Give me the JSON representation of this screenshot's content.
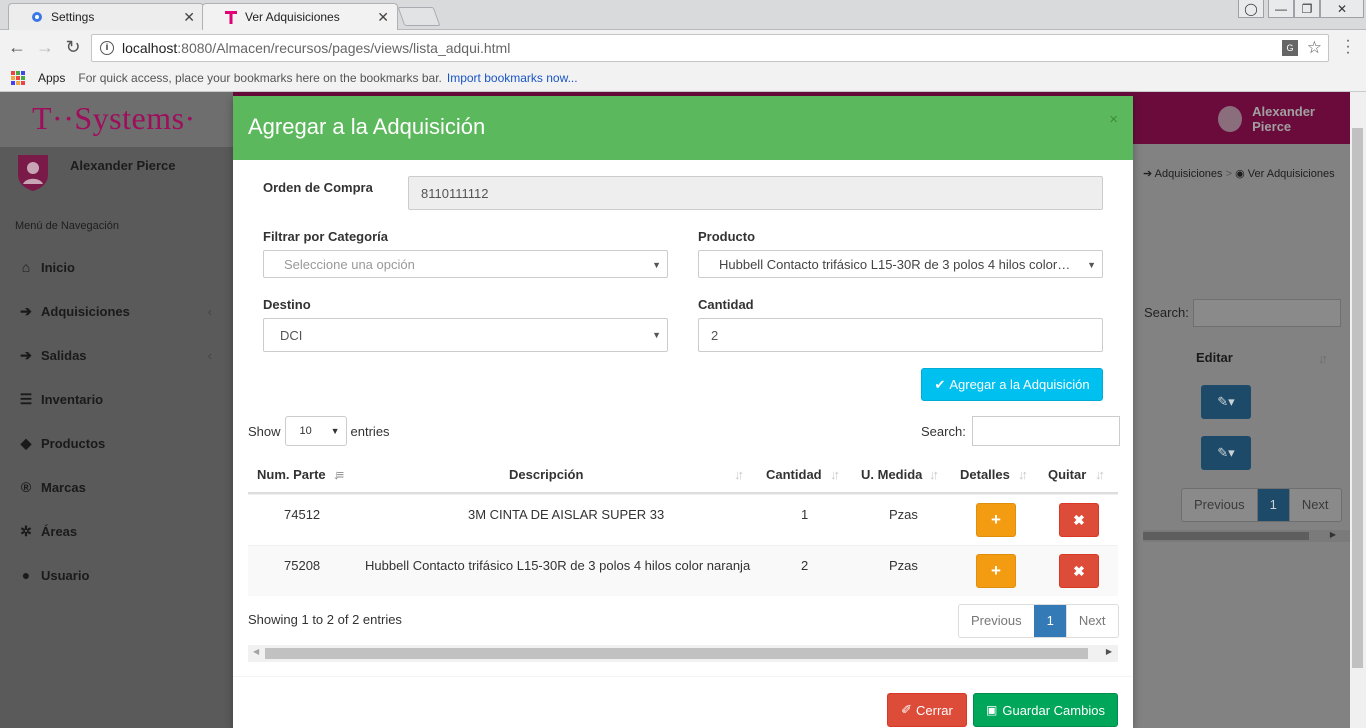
{
  "browser": {
    "tabs": [
      {
        "title": "Settings"
      },
      {
        "title": "Ver Adquisiciones"
      }
    ],
    "url_host": "localhost",
    "url_path": ":8080/Almacen/recursos/pages/views/lista_adqui.html",
    "bookmarks": {
      "apps": "Apps",
      "hint": "For quick access, place your bookmarks here on the bookmarks bar.",
      "import": "Import bookmarks now..."
    }
  },
  "app": {
    "logo": "T··Systems·",
    "user": "Alexander Pierce",
    "top_user": "Alexander Pierce",
    "menu_header": "Menú de Navegación",
    "menu": [
      {
        "label": "Inicio",
        "icon": "home-icon"
      },
      {
        "label": "Adquisiciones",
        "icon": "arrow-circle-icon"
      },
      {
        "label": "Salidas",
        "icon": "arrow-circle-icon"
      },
      {
        "label": "Inventario",
        "icon": "list-icon"
      },
      {
        "label": "Productos",
        "icon": "tags-icon"
      },
      {
        "label": "Marcas",
        "icon": "registered-icon"
      },
      {
        "label": "Áreas",
        "icon": "gear-icon"
      },
      {
        "label": "Usuario",
        "icon": "user-icon"
      }
    ],
    "breadcrumb": [
      "Adquisiciones",
      "Ver Adquisiciones"
    ],
    "bg_search_label": "Search:",
    "bg_column": "Editar",
    "bg_pagination": [
      "Previous",
      "1",
      "Next"
    ]
  },
  "modal": {
    "title": "Agregar a la Adquisición",
    "close": "×",
    "orden_label": "Orden de Compra",
    "orden_value": "8110111112",
    "categoria_label": "Filtrar por Categoría",
    "categoria_placeholder": "Seleccione una opción",
    "producto_label": "Producto",
    "producto_value": "Hubbell Contacto trifásico L15-30R de 3 polos 4 hilos color…",
    "destino_label": "Destino",
    "destino_value": "DCI",
    "cantidad_label": "Cantidad",
    "cantidad_value": "2",
    "add_button": "Agregar a la Adquisición",
    "show_label": "Show",
    "entries_value": "10",
    "entries_label": "entries",
    "search_label": "Search:",
    "columns": [
      "Num. Parte",
      "Descripción",
      "Cantidad",
      "U. Medida",
      "Detalles",
      "Quitar"
    ],
    "rows": [
      {
        "parte": "74512",
        "descripcion": "3M CINTA DE AISLAR SUPER 33",
        "cantidad": "1",
        "medida": "Pzas"
      },
      {
        "parte": "75208",
        "descripcion": "Hubbell Contacto trifásico L15-30R de 3 polos 4 hilos color naranja",
        "cantidad": "2",
        "medida": "Pzas"
      }
    ],
    "info": "Showing 1 to 2 of 2 entries",
    "pagination": [
      "Previous",
      "1",
      "Next"
    ],
    "cerrar": "Cerrar",
    "guardar": "Guardar Cambios",
    "colors": {
      "header": "#5cb85c",
      "info_button": "#00c0ef",
      "warning": "#f39c12",
      "danger": "#dd4b39",
      "success": "#00a65a"
    }
  }
}
